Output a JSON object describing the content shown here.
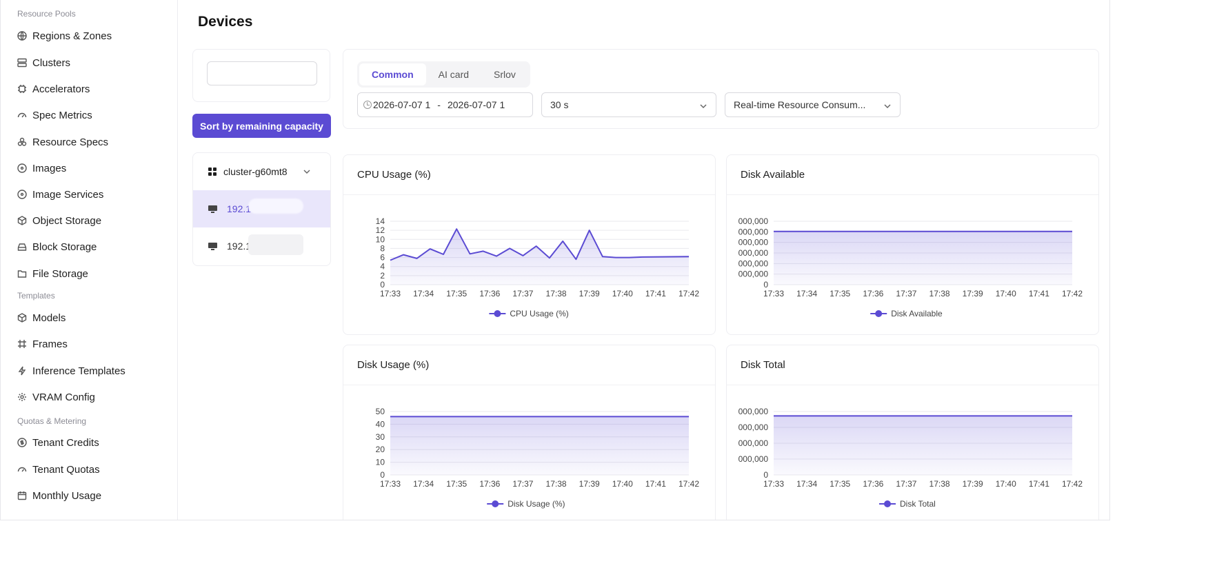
{
  "sidebar": {
    "groups": [
      {
        "title": "Resource Pools"
      },
      {
        "title": "Templates"
      },
      {
        "title": "Quotas & Metering"
      }
    ],
    "items": [
      {
        "label": "Regions & Zones",
        "icon": "globe-icon"
      },
      {
        "label": "Clusters",
        "icon": "server-icon"
      },
      {
        "label": "Accelerators",
        "icon": "chip-icon"
      },
      {
        "label": "Spec Metrics",
        "icon": "gauge-icon"
      },
      {
        "label": "Resource Specs",
        "icon": "boxes-icon"
      },
      {
        "label": "Images",
        "icon": "disc-icon"
      },
      {
        "label": "Image Services",
        "icon": "disc-icon"
      },
      {
        "label": "Object Storage",
        "icon": "cube-icon"
      },
      {
        "label": "Block Storage",
        "icon": "drive-icon"
      },
      {
        "label": "File Storage",
        "icon": "folder-icon"
      },
      {
        "label": "Models",
        "icon": "cube-icon"
      },
      {
        "label": "Frames",
        "icon": "frame-icon"
      },
      {
        "label": "Inference Templates",
        "icon": "lightning-icon"
      },
      {
        "label": "VRAM Config",
        "icon": "gear-icon"
      },
      {
        "label": "Tenant Credits",
        "icon": "coin-icon"
      },
      {
        "label": "Tenant Quotas",
        "icon": "gauge-icon"
      },
      {
        "label": "Monthly Usage",
        "icon": "calendar-icon"
      }
    ]
  },
  "page": {
    "title": "Devices"
  },
  "search": {
    "value": "",
    "placeholder": ""
  },
  "sort_button": "Sort by remaining capacity",
  "tree": {
    "cluster": "cluster-g60mt8",
    "nodes": [
      {
        "label": "192.1"
      },
      {
        "label": "192.1"
      }
    ]
  },
  "tabs": [
    {
      "label": "Common",
      "active": true
    },
    {
      "label": "AI card",
      "active": false
    },
    {
      "label": "Srlov",
      "active": false
    }
  ],
  "filters": {
    "date_start": "2026-07-07 1",
    "date_sep": "-",
    "date_end": "2026-07-07 1",
    "interval": "30 s",
    "mode": "Real-time Resource Consum..."
  },
  "colors": {
    "accent": "#5b4bd3",
    "series": "#5b4bd3",
    "fill": "#ece9fb"
  },
  "chart_data": [
    {
      "type": "area",
      "title": "CPU Usage (%)",
      "x": [
        "17:33",
        "17:34",
        "17:35",
        "17:36",
        "17:37",
        "17:38",
        "17:39",
        "17:40",
        "17:41",
        "17:42"
      ],
      "yticks": [
        "0",
        "2",
        "4",
        "6",
        "8",
        "10",
        "12",
        "14"
      ],
      "ylim": [
        0,
        14
      ],
      "series": [
        {
          "name": "CPU Usage (%)",
          "points": [
            [
              0,
              5.4
            ],
            [
              0.4,
              6.6
            ],
            [
              0.8,
              5.8
            ],
            [
              1.2,
              7.9
            ],
            [
              1.6,
              6.7
            ],
            [
              2.0,
              12.3
            ],
            [
              2.4,
              6.8
            ],
            [
              2.8,
              7.4
            ],
            [
              3.2,
              6.3
            ],
            [
              3.6,
              8.0
            ],
            [
              4.0,
              6.4
            ],
            [
              4.4,
              8.5
            ],
            [
              4.8,
              5.9
            ],
            [
              5.2,
              9.6
            ],
            [
              5.6,
              5.6
            ],
            [
              6.0,
              12.0
            ],
            [
              6.4,
              6.2
            ],
            [
              6.8,
              6.0
            ],
            [
              7.2,
              6.0
            ],
            [
              7.6,
              6.1
            ],
            [
              9.0,
              6.2
            ]
          ]
        }
      ],
      "legend": "bottom"
    },
    {
      "type": "area",
      "title": "Disk Available",
      "x": [
        "17:33",
        "17:34",
        "17:35",
        "17:36",
        "17:37",
        "17:38",
        "17:39",
        "17:40",
        "17:41",
        "17:42"
      ],
      "yticks": [
        "0",
        "000,000",
        "000,000",
        "000,000",
        "000,000",
        "000,000",
        "000,000"
      ],
      "ylim": [
        0,
        6.2
      ],
      "series": [
        {
          "name": "Disk Available",
          "points": [
            [
              0,
              5.2
            ],
            [
              9,
              5.2
            ]
          ]
        }
      ],
      "legend": "bottom"
    },
    {
      "type": "area",
      "title": "Disk Usage (%)",
      "x": [
        "17:33",
        "17:34",
        "17:35",
        "17:36",
        "17:37",
        "17:38",
        "17:39",
        "17:40",
        "17:41",
        "17:42"
      ],
      "yticks": [
        "0",
        "10",
        "20",
        "30",
        "40",
        "50"
      ],
      "ylim": [
        0,
        50
      ],
      "series": [
        {
          "name": "Disk Usage (%)",
          "points": [
            [
              0,
              46
            ],
            [
              9,
              46
            ]
          ]
        }
      ],
      "legend": "bottom"
    },
    {
      "type": "area",
      "title": "Disk Total",
      "x": [
        "17:33",
        "17:34",
        "17:35",
        "17:36",
        "17:37",
        "17:38",
        "17:39",
        "17:40",
        "17:41",
        "17:42"
      ],
      "yticks": [
        "0",
        "000,000",
        "000,000",
        "000,000",
        "000,000"
      ],
      "ylim": [
        0,
        4.3
      ],
      "series": [
        {
          "name": "Disk Total",
          "points": [
            [
              0,
              4.0
            ],
            [
              9,
              4.0
            ]
          ]
        }
      ],
      "legend": "bottom"
    }
  ]
}
